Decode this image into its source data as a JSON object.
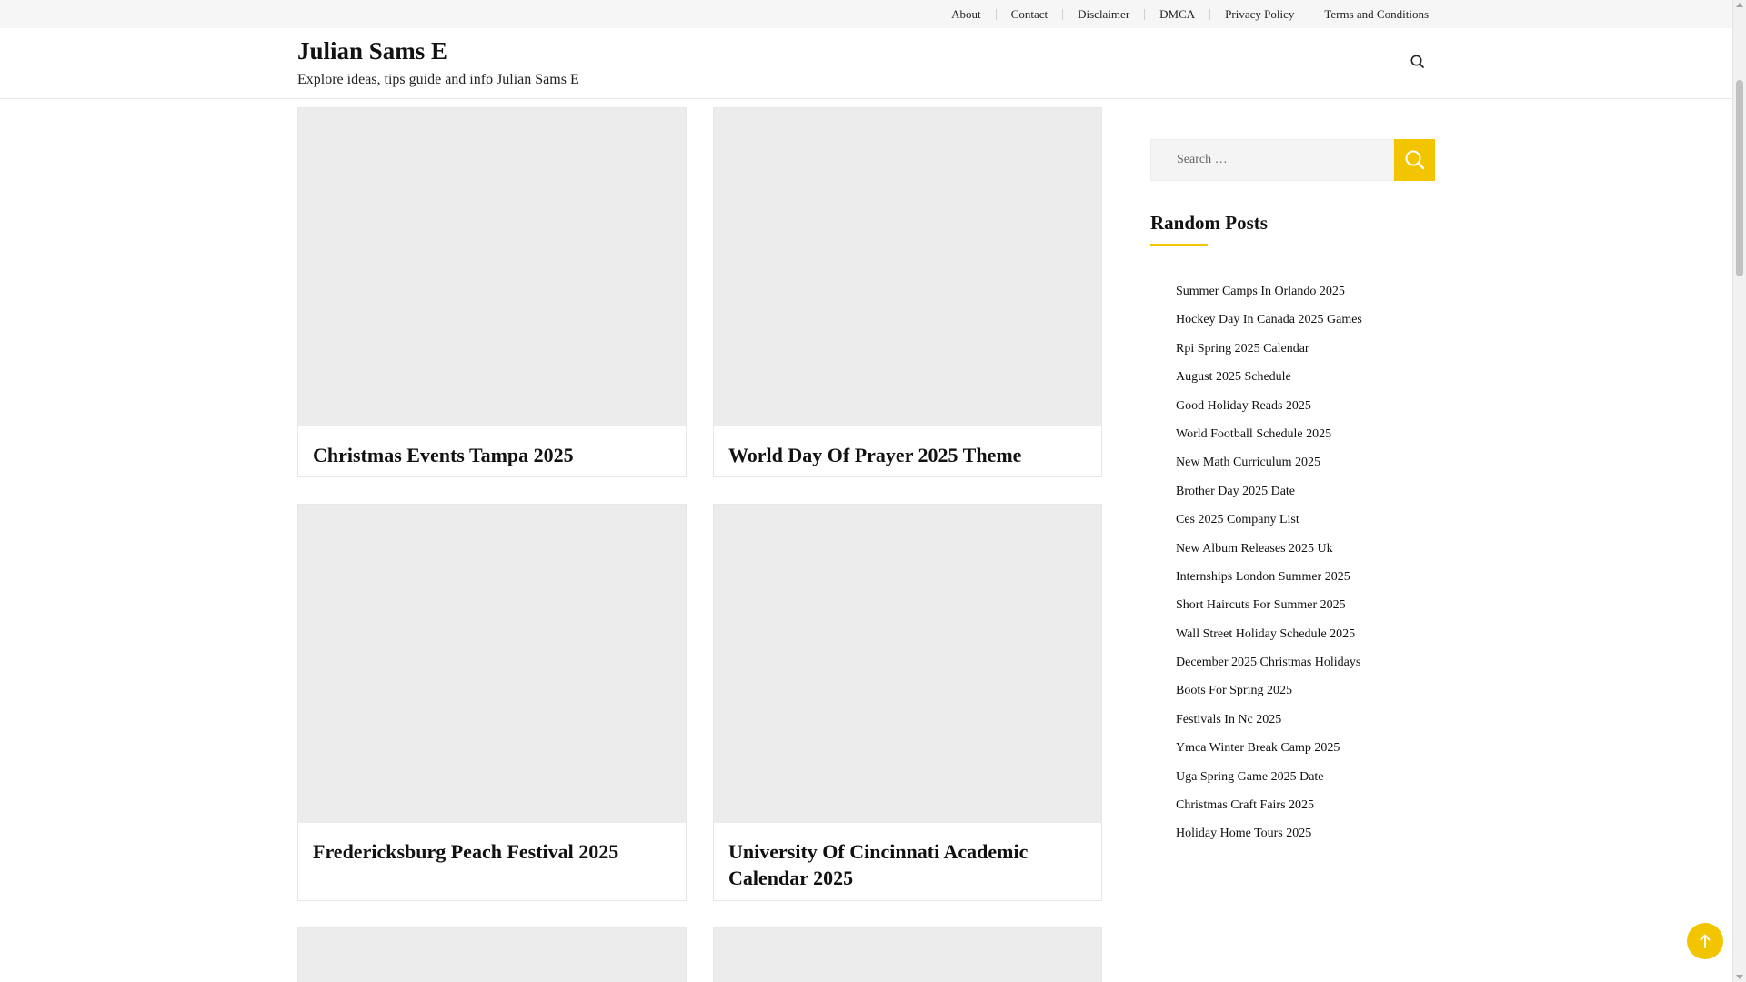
{
  "topnav": {
    "links": [
      "About",
      "Contact",
      "Disclaimer",
      "DMCA",
      "Privacy Policy",
      "Terms and Conditions"
    ]
  },
  "header": {
    "site_title": "Julian Sams E",
    "tagline": "Explore ideas, tips guide and info Julian Sams E",
    "search_icon": "search-icon"
  },
  "posts": [
    {
      "title": "Christmas Events Tampa 2025"
    },
    {
      "title": "World Day Of Prayer 2025 Theme"
    },
    {
      "title": "Fredericksburg Peach Festival 2025"
    },
    {
      "title": "University Of Cincinnati Academic Calendar 2025"
    }
  ],
  "sidebar": {
    "search_placeholder": "Search …",
    "search_button_icon": "search-icon",
    "widget_title": "Random Posts",
    "random_posts": [
      "Summer Camps In Orlando 2025",
      "Hockey Day In Canada 2025 Games",
      "Rpi Spring 2025 Calendar",
      "August 2025 Schedule",
      "Good Holiday Reads 2025",
      "World Football Schedule 2025",
      "New Math Curriculum 2025",
      "Brother Day 2025 Date",
      "Ces 2025 Company List",
      "New Album Releases 2025 Uk",
      "Internships London Summer 2025",
      "Short Haircuts For Summer 2025",
      "Wall Street Holiday Schedule 2025",
      "December 2025 Christmas Holidays",
      "Boots For Spring 2025",
      "Festivals In Nc 2025",
      "Ymca Winter Break Camp 2025",
      "Uga Spring Game 2025 Date",
      "Christmas Craft Fairs 2025",
      "Holiday Home Tours 2025"
    ]
  },
  "back_to_top_icon": "arrow-up-icon",
  "colors": {
    "accent": "#f3c400",
    "topbar_bg": "#f6f6f6",
    "thumb_bg": "#ececec"
  }
}
